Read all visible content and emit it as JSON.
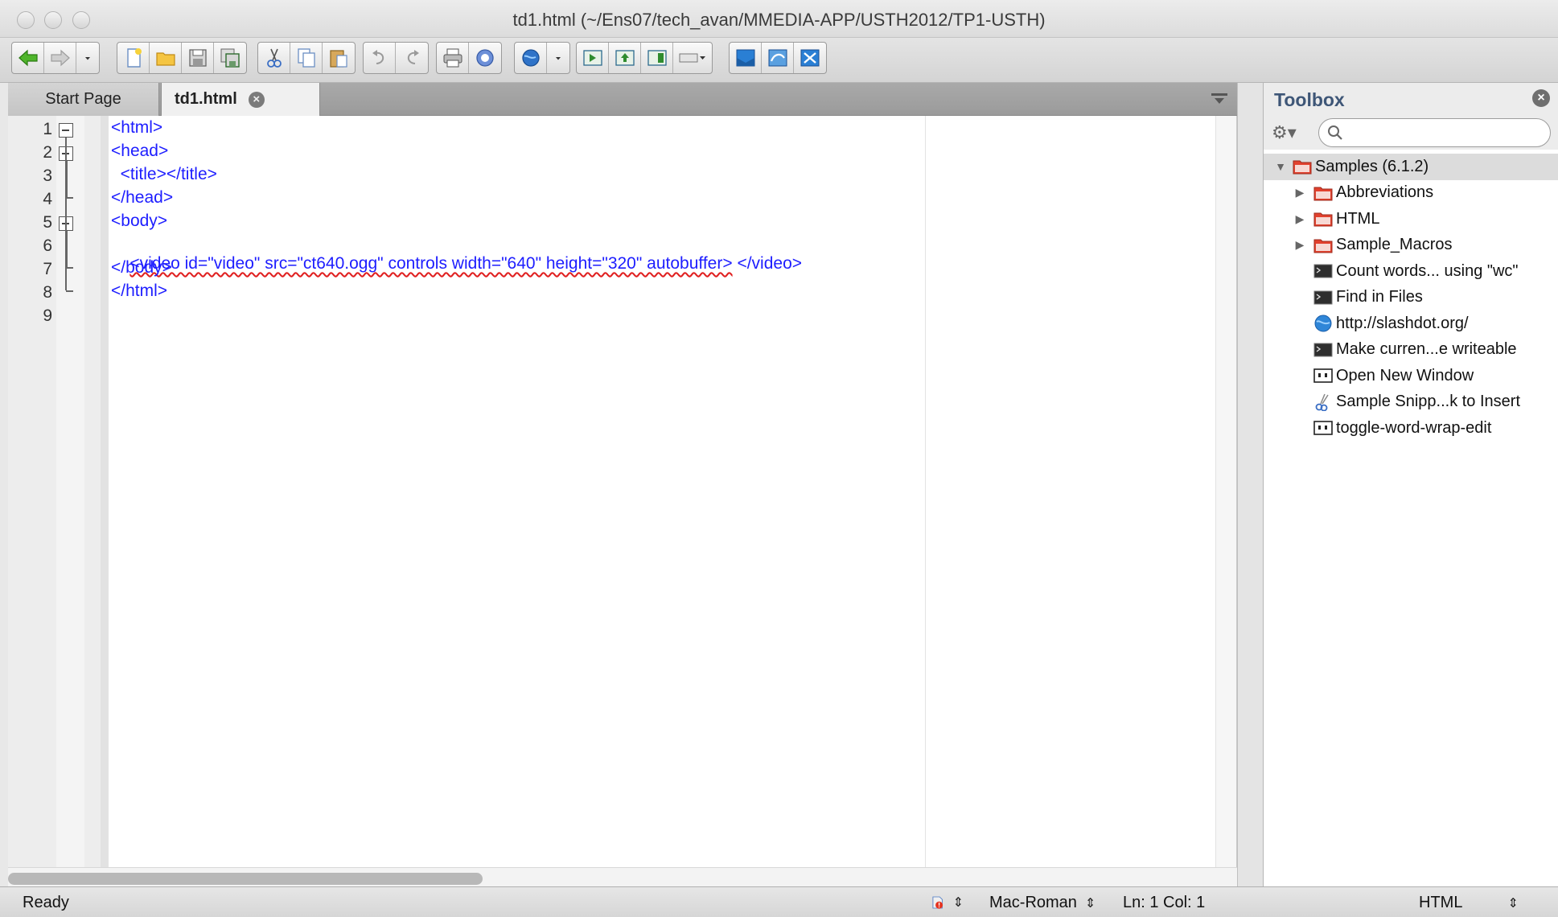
{
  "window": {
    "title": "td1.html (~/Ens07/tech_avan/MMEDIA-APP/USTH2012/TP1-USTH)"
  },
  "toolbar": {
    "buttons": [
      "back-icon",
      "forward-icon",
      "history-dropdown-icon",
      "new-file-icon",
      "open-folder-icon",
      "save-icon",
      "save-all-icon",
      "cut-icon",
      "copy-icon",
      "paste-icon",
      "undo-icon",
      "redo-icon",
      "print-icon",
      "help-icon",
      "browser-preview-icon",
      "run-icon",
      "upload-icon",
      "split-view-icon",
      "window-layout-icon",
      "toolbox-toggle-icon",
      "sync-icon",
      "remote-icon"
    ]
  },
  "tabs": [
    {
      "label": "Start Page",
      "active": false
    },
    {
      "label": "td1.html",
      "active": true
    }
  ],
  "editor": {
    "lines": [
      {
        "n": "1",
        "text": "<html>"
      },
      {
        "n": "2",
        "text": "<head>"
      },
      {
        "n": "3",
        "text": "  <title></title>"
      },
      {
        "n": "4",
        "text": "</head>"
      },
      {
        "n": "5",
        "text": "<body>"
      },
      {
        "n": "6",
        "text": "<video id=\"video\" src=\"ct640.ogg\" controls width=\"640\" height=\"320\" autobuffer>",
        "tail": " </video>"
      },
      {
        "n": "7",
        "text": "</body>"
      },
      {
        "n": "8",
        "text": "</html>"
      },
      {
        "n": "9",
        "text": ""
      }
    ],
    "code_color": "#1d1dff",
    "error_underline_color": "#e02020"
  },
  "toolbox": {
    "title": "Toolbox",
    "search_value": "",
    "items": [
      {
        "label": "Samples (6.1.2)",
        "icon": "folder-icon",
        "level": 0,
        "expander": "expanded"
      },
      {
        "label": "Abbreviations",
        "icon": "folder-icon",
        "level": 1,
        "expander": "collapsed"
      },
      {
        "label": "HTML",
        "icon": "folder-icon",
        "level": 1,
        "expander": "collapsed"
      },
      {
        "label": "Sample_Macros",
        "icon": "folder-icon",
        "level": 1,
        "expander": "collapsed"
      },
      {
        "label": "Count words... using \"wc\"",
        "icon": "terminal-icon",
        "level": 1,
        "expander": "none"
      },
      {
        "label": "Find in Files",
        "icon": "terminal-icon",
        "level": 1,
        "expander": "none"
      },
      {
        "label": "http://slashdot.org/",
        "icon": "globe-icon",
        "level": 1,
        "expander": "none"
      },
      {
        "label": "Make curren...e writeable",
        "icon": "terminal-icon",
        "level": 1,
        "expander": "none"
      },
      {
        "label": "Open New Window",
        "icon": "command-icon",
        "level": 1,
        "expander": "none"
      },
      {
        "label": "Sample Snipp...k to Insert",
        "icon": "scissors-icon",
        "level": 1,
        "expander": "none"
      },
      {
        "label": "toggle-word-wrap-edit",
        "icon": "command-icon",
        "level": 1,
        "expander": "none"
      }
    ],
    "title_color": "#3e5677",
    "folder_color": "#e2412e"
  },
  "status": {
    "ready": "Ready",
    "encoding": "Mac-Roman",
    "position": "Ln: 1 Col: 1",
    "language": "HTML"
  }
}
